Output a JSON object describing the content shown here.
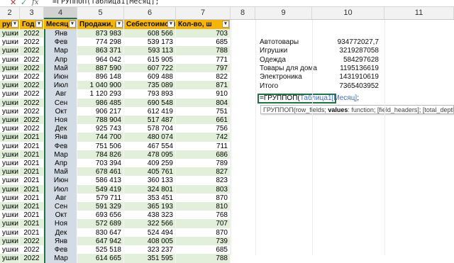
{
  "formula_bar": {
    "formula": "=ГРУППОП(Таблица1[Месяц];",
    "cancel_icon": "close-icon",
    "confirm_icon": "check-icon",
    "fx_label": "fx"
  },
  "columns": [
    "2",
    "3",
    "4",
    "5",
    "6",
    "7",
    "8",
    "9",
    "10",
    "11"
  ],
  "table": {
    "headers": [
      "Группа",
      "Год",
      "Месяц",
      "Продажи, ру",
      "Себестоимость, р",
      "Кол-во, ш"
    ],
    "visible_headers": [
      "руппа",
      "Год",
      "Месяц",
      "Продажи, ру",
      "Себестоимость, р",
      "Кол-во, ш"
    ],
    "rows": [
      [
        "ушки",
        "2022",
        "Янв",
        "873 983",
        "608 566",
        "703"
      ],
      [
        "ушки",
        "2022",
        "Фев",
        "774 298",
        "539 173",
        "685"
      ],
      [
        "ушки",
        "2022",
        "Мар",
        "863 371",
        "593 113",
        "788"
      ],
      [
        "ушки",
        "2022",
        "Апр",
        "964 042",
        "615 905",
        "771"
      ],
      [
        "ушки",
        "2022",
        "Май",
        "887 590",
        "607 722",
        "797"
      ],
      [
        "ушки",
        "2022",
        "Июн",
        "896 148",
        "609 488",
        "822"
      ],
      [
        "ушки",
        "2022",
        "Июл",
        "1 040 900",
        "735 089",
        "871"
      ],
      [
        "ушки",
        "2022",
        "Авг",
        "1 120 293",
        "793 893",
        "910"
      ],
      [
        "ушки",
        "2022",
        "Сен",
        "986 485",
        "690 548",
        "804"
      ],
      [
        "ушки",
        "2022",
        "Окт",
        "906 217",
        "612 419",
        "751"
      ],
      [
        "ушки",
        "2022",
        "Ноя",
        "788 904",
        "517 487",
        "661"
      ],
      [
        "ушки",
        "2022",
        "Дек",
        "925 743",
        "578 704",
        "756"
      ],
      [
        "ушки",
        "2021",
        "Янв",
        "744 700",
        "480 074",
        "742"
      ],
      [
        "ушки",
        "2021",
        "Фев",
        "751 506",
        "467 554",
        "711"
      ],
      [
        "ушки",
        "2021",
        "Мар",
        "784 826",
        "478 095",
        "686"
      ],
      [
        "ушки",
        "2021",
        "Апр",
        "703 394",
        "409 259",
        "789"
      ],
      [
        "ушки",
        "2021",
        "Май",
        "678 461",
        "405 761",
        "827"
      ],
      [
        "ушки",
        "2021",
        "Июн",
        "586 413",
        "360 133",
        "823"
      ],
      [
        "ушки",
        "2021",
        "Июл",
        "549 419",
        "324 801",
        "803"
      ],
      [
        "ушки",
        "2021",
        "Авг",
        "579 711",
        "353 451",
        "870"
      ],
      [
        "ушки",
        "2021",
        "Сен",
        "591 329",
        "365 193",
        "810"
      ],
      [
        "ушки",
        "2021",
        "Окт",
        "693 656",
        "438 323",
        "768"
      ],
      [
        "ушки",
        "2021",
        "Ноя",
        "572 689",
        "322 566",
        "707"
      ],
      [
        "ушки",
        "2021",
        "Дек",
        "830 647",
        "524 494",
        "870"
      ],
      [
        "ушки",
        "2022",
        "Янв",
        "647 942",
        "408 005",
        "739"
      ],
      [
        "ушки",
        "2022",
        "Фев",
        "525 518",
        "323 237",
        "685"
      ],
      [
        "ушки",
        "2022",
        "Мар",
        "614 665",
        "351 595",
        "788"
      ]
    ]
  },
  "summary": [
    {
      "label": "Автотовары",
      "value": "934772027,7"
    },
    {
      "label": "Игрушки",
      "value": "3219287058"
    },
    {
      "label": "Одежда",
      "value": "584297628"
    },
    {
      "label": "Товары для дома",
      "value": "1195136619"
    },
    {
      "label": "Электроника",
      "value": "1431910619"
    },
    {
      "label": "Итого",
      "value": "7365403952"
    }
  ],
  "editing_cell": {
    "func": "=ГРУППОП(",
    "ref": "Таблица1[Месяц]",
    "tail": ";"
  },
  "tooltip": {
    "name": "ГРУППОП(row_fields; ",
    "bold_arg": "values",
    "rest": ": function; [field_headers]; [total_depth]; [sort_ord"
  }
}
